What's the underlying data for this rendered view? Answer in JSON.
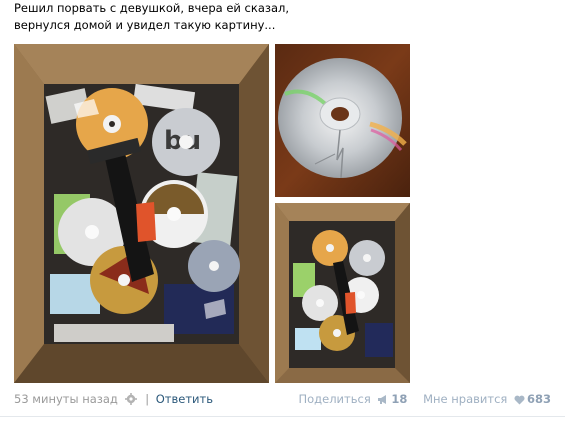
{
  "post": {
    "text_line1": "Решил порвать с девушкой, вчера ей сказал,",
    "text_line2": "вернулся домой и увидел такую картину...",
    "time": "53 минуты назад",
    "reply_label": "Ответить",
    "share_label": "Поделиться",
    "share_count": "18",
    "like_label": "Мне нравится",
    "like_count": "683"
  },
  "icons": {
    "settings": "gear-icon",
    "share": "megaphone-icon",
    "like": "heart-icon"
  },
  "colors": {
    "link": "#2b587a",
    "muted": "#9a9a9a",
    "action": "#9fb0c2"
  }
}
